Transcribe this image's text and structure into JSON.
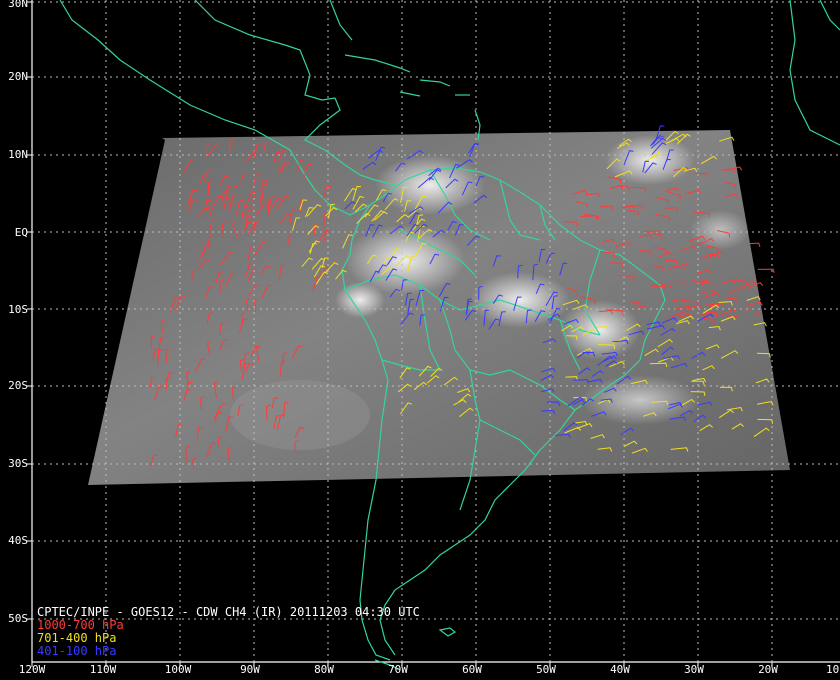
{
  "map": {
    "lat_labels": [
      "30N",
      "20N",
      "10N",
      "EQ",
      "10S",
      "20S",
      "30S",
      "40S",
      "50S"
    ],
    "lon_labels": [
      "120W",
      "110W",
      "100W",
      "90W",
      "80W",
      "70W",
      "60W",
      "50W",
      "40W",
      "30W",
      "20W",
      "10"
    ]
  },
  "caption": {
    "title": "CPTEC/INPE - GOES12 - CDW CH4 (IR) 20111203 04:30 UTC",
    "legend": [
      {
        "label": "1000-700 hPa",
        "color": "#ff3b3b"
      },
      {
        "label": "701-400 hPa",
        "color": "#f0e020"
      },
      {
        "label": "401-100 hPa",
        "color": "#3a3aff"
      }
    ]
  },
  "colors": {
    "background": "#000000",
    "grid": "#bdbdbd",
    "coastline": "#35d49a",
    "satellite": "#7a7a7a"
  }
}
